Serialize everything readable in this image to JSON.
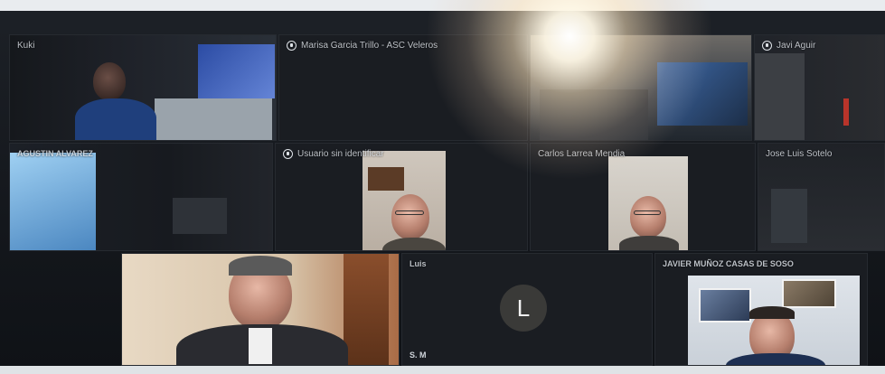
{
  "meeting": {
    "tiles": {
      "t1": {
        "name": "Kuki"
      },
      "t2": {
        "name": "Marisa Garcia Trillo - ASC Veleros",
        "mic": "muted-mic-icon"
      },
      "t3": {
        "name": ""
      },
      "t4": {
        "name": "Javi Aguir",
        "mic": "muted-mic-icon"
      },
      "t5": {
        "name": "AGUSTIN ALVAREZ"
      },
      "t6": {
        "name": "Usuario sin identificar",
        "mic": "muted-mic-icon"
      },
      "t7": {
        "name": "Carlos Larrea Mendia"
      },
      "t8": {
        "name": "Jose Luis Sotelo"
      },
      "t9": {
        "name": ""
      },
      "t10": {
        "name": "Luis",
        "avatar_letter": "L",
        "footer": "S. M"
      },
      "t11": {
        "name": "JAVIER MUÑOZ CASAS DE SOSO"
      }
    }
  },
  "colors": {
    "background": "#1b1e24",
    "tile": "#1a1d22",
    "avatar": "#3a3a38",
    "text": "#d8dde3"
  }
}
